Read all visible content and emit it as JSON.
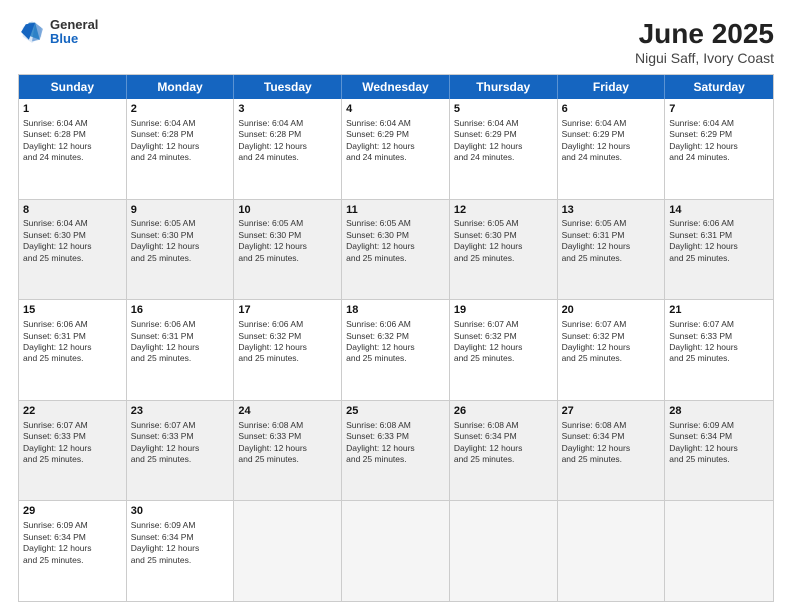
{
  "logo": {
    "general": "General",
    "blue": "Blue"
  },
  "title": "June 2025",
  "subtitle": "Nigui Saff, Ivory Coast",
  "header_days": [
    "Sunday",
    "Monday",
    "Tuesday",
    "Wednesday",
    "Thursday",
    "Friday",
    "Saturday"
  ],
  "weeks": [
    [
      {
        "day": "1",
        "info": "Sunrise: 6:04 AM\nSunset: 6:28 PM\nDaylight: 12 hours\nand 24 minutes.",
        "shaded": false,
        "empty": false
      },
      {
        "day": "2",
        "info": "Sunrise: 6:04 AM\nSunset: 6:28 PM\nDaylight: 12 hours\nand 24 minutes.",
        "shaded": false,
        "empty": false
      },
      {
        "day": "3",
        "info": "Sunrise: 6:04 AM\nSunset: 6:28 PM\nDaylight: 12 hours\nand 24 minutes.",
        "shaded": false,
        "empty": false
      },
      {
        "day": "4",
        "info": "Sunrise: 6:04 AM\nSunset: 6:29 PM\nDaylight: 12 hours\nand 24 minutes.",
        "shaded": false,
        "empty": false
      },
      {
        "day": "5",
        "info": "Sunrise: 6:04 AM\nSunset: 6:29 PM\nDaylight: 12 hours\nand 24 minutes.",
        "shaded": false,
        "empty": false
      },
      {
        "day": "6",
        "info": "Sunrise: 6:04 AM\nSunset: 6:29 PM\nDaylight: 12 hours\nand 24 minutes.",
        "shaded": false,
        "empty": false
      },
      {
        "day": "7",
        "info": "Sunrise: 6:04 AM\nSunset: 6:29 PM\nDaylight: 12 hours\nand 24 minutes.",
        "shaded": false,
        "empty": false
      }
    ],
    [
      {
        "day": "8",
        "info": "Sunrise: 6:04 AM\nSunset: 6:30 PM\nDaylight: 12 hours\nand 25 minutes.",
        "shaded": true,
        "empty": false
      },
      {
        "day": "9",
        "info": "Sunrise: 6:05 AM\nSunset: 6:30 PM\nDaylight: 12 hours\nand 25 minutes.",
        "shaded": true,
        "empty": false
      },
      {
        "day": "10",
        "info": "Sunrise: 6:05 AM\nSunset: 6:30 PM\nDaylight: 12 hours\nand 25 minutes.",
        "shaded": true,
        "empty": false
      },
      {
        "day": "11",
        "info": "Sunrise: 6:05 AM\nSunset: 6:30 PM\nDaylight: 12 hours\nand 25 minutes.",
        "shaded": true,
        "empty": false
      },
      {
        "day": "12",
        "info": "Sunrise: 6:05 AM\nSunset: 6:30 PM\nDaylight: 12 hours\nand 25 minutes.",
        "shaded": true,
        "empty": false
      },
      {
        "day": "13",
        "info": "Sunrise: 6:05 AM\nSunset: 6:31 PM\nDaylight: 12 hours\nand 25 minutes.",
        "shaded": true,
        "empty": false
      },
      {
        "day": "14",
        "info": "Sunrise: 6:06 AM\nSunset: 6:31 PM\nDaylight: 12 hours\nand 25 minutes.",
        "shaded": true,
        "empty": false
      }
    ],
    [
      {
        "day": "15",
        "info": "Sunrise: 6:06 AM\nSunset: 6:31 PM\nDaylight: 12 hours\nand 25 minutes.",
        "shaded": false,
        "empty": false
      },
      {
        "day": "16",
        "info": "Sunrise: 6:06 AM\nSunset: 6:31 PM\nDaylight: 12 hours\nand 25 minutes.",
        "shaded": false,
        "empty": false
      },
      {
        "day": "17",
        "info": "Sunrise: 6:06 AM\nSunset: 6:32 PM\nDaylight: 12 hours\nand 25 minutes.",
        "shaded": false,
        "empty": false
      },
      {
        "day": "18",
        "info": "Sunrise: 6:06 AM\nSunset: 6:32 PM\nDaylight: 12 hours\nand 25 minutes.",
        "shaded": false,
        "empty": false
      },
      {
        "day": "19",
        "info": "Sunrise: 6:07 AM\nSunset: 6:32 PM\nDaylight: 12 hours\nand 25 minutes.",
        "shaded": false,
        "empty": false
      },
      {
        "day": "20",
        "info": "Sunrise: 6:07 AM\nSunset: 6:32 PM\nDaylight: 12 hours\nand 25 minutes.",
        "shaded": false,
        "empty": false
      },
      {
        "day": "21",
        "info": "Sunrise: 6:07 AM\nSunset: 6:33 PM\nDaylight: 12 hours\nand 25 minutes.",
        "shaded": false,
        "empty": false
      }
    ],
    [
      {
        "day": "22",
        "info": "Sunrise: 6:07 AM\nSunset: 6:33 PM\nDaylight: 12 hours\nand 25 minutes.",
        "shaded": true,
        "empty": false
      },
      {
        "day": "23",
        "info": "Sunrise: 6:07 AM\nSunset: 6:33 PM\nDaylight: 12 hours\nand 25 minutes.",
        "shaded": true,
        "empty": false
      },
      {
        "day": "24",
        "info": "Sunrise: 6:08 AM\nSunset: 6:33 PM\nDaylight: 12 hours\nand 25 minutes.",
        "shaded": true,
        "empty": false
      },
      {
        "day": "25",
        "info": "Sunrise: 6:08 AM\nSunset: 6:33 PM\nDaylight: 12 hours\nand 25 minutes.",
        "shaded": true,
        "empty": false
      },
      {
        "day": "26",
        "info": "Sunrise: 6:08 AM\nSunset: 6:34 PM\nDaylight: 12 hours\nand 25 minutes.",
        "shaded": true,
        "empty": false
      },
      {
        "day": "27",
        "info": "Sunrise: 6:08 AM\nSunset: 6:34 PM\nDaylight: 12 hours\nand 25 minutes.",
        "shaded": true,
        "empty": false
      },
      {
        "day": "28",
        "info": "Sunrise: 6:09 AM\nSunset: 6:34 PM\nDaylight: 12 hours\nand 25 minutes.",
        "shaded": true,
        "empty": false
      }
    ],
    [
      {
        "day": "29",
        "info": "Sunrise: 6:09 AM\nSunset: 6:34 PM\nDaylight: 12 hours\nand 25 minutes.",
        "shaded": false,
        "empty": false
      },
      {
        "day": "30",
        "info": "Sunrise: 6:09 AM\nSunset: 6:34 PM\nDaylight: 12 hours\nand 25 minutes.",
        "shaded": false,
        "empty": false
      },
      {
        "day": "",
        "info": "",
        "shaded": false,
        "empty": true
      },
      {
        "day": "",
        "info": "",
        "shaded": false,
        "empty": true
      },
      {
        "day": "",
        "info": "",
        "shaded": false,
        "empty": true
      },
      {
        "day": "",
        "info": "",
        "shaded": false,
        "empty": true
      },
      {
        "day": "",
        "info": "",
        "shaded": false,
        "empty": true
      }
    ]
  ]
}
